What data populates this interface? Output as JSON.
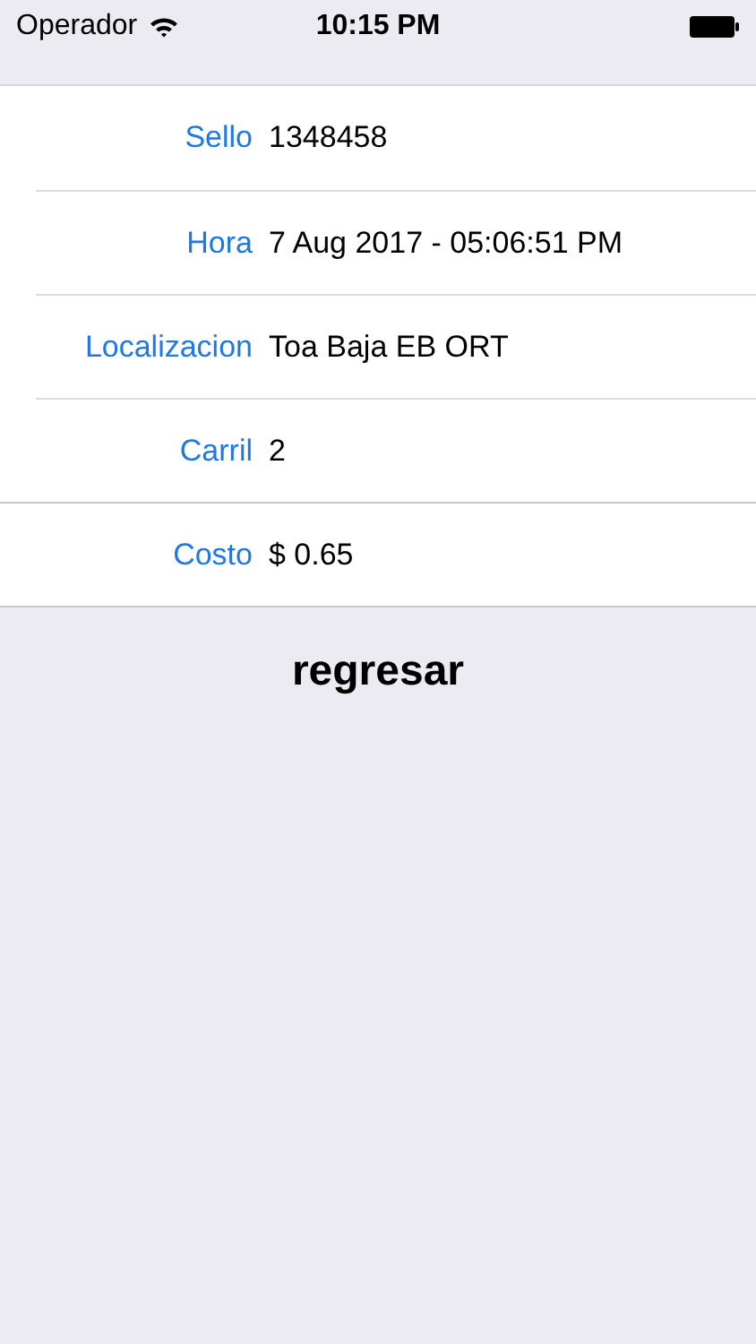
{
  "status_bar": {
    "carrier": "Operador",
    "time": "10:15 PM"
  },
  "rows": [
    {
      "label": "Sello",
      "value": "1348458"
    },
    {
      "label": "Hora",
      "value": "7 Aug 2017 - 05:06:51 PM"
    },
    {
      "label": "Localizacion",
      "value": "Toa Baja EB ORT"
    },
    {
      "label": "Carril",
      "value": "2"
    },
    {
      "label": "Costo",
      "value": "$ 0.65"
    }
  ],
  "button": "regresar"
}
